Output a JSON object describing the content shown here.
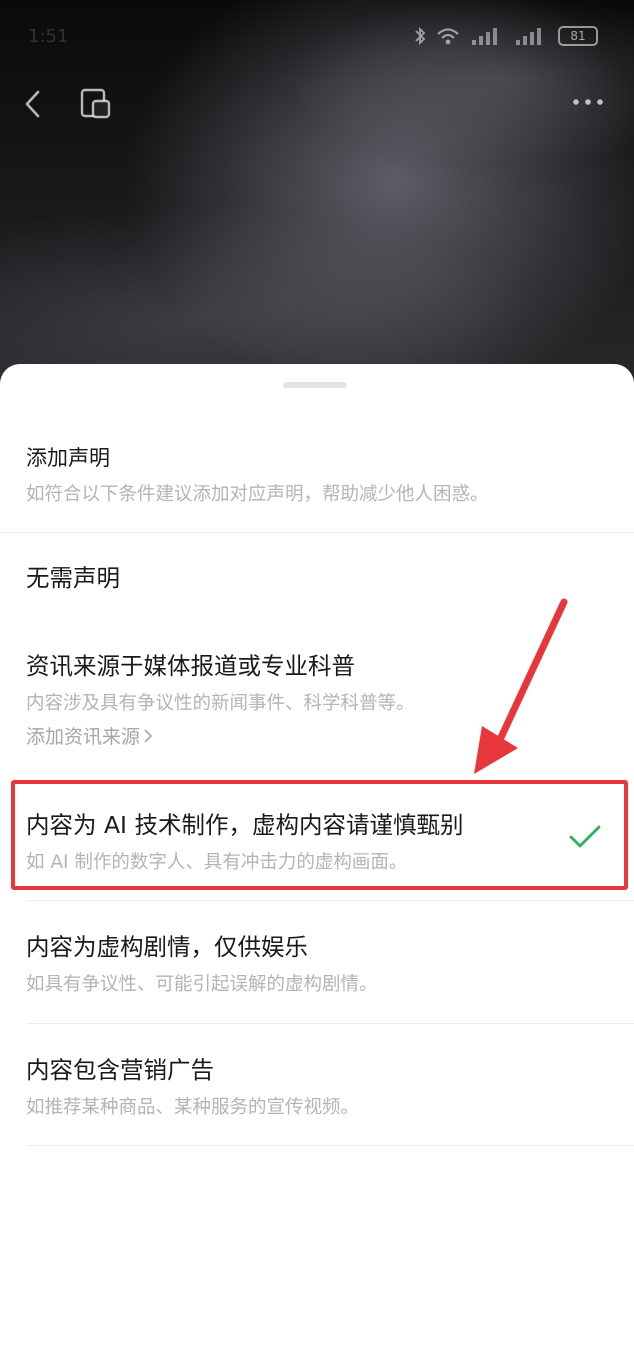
{
  "status_bar": {
    "time": "1:51",
    "battery": "81"
  },
  "nav": {
    "back_icon": "back-arrow-icon",
    "window_icon": "floating-window-icon",
    "more_icon": "more-icon"
  },
  "sheet": {
    "header": {
      "title": "添加声明",
      "subtitle": "如符合以下条件建议添加对应声明，帮助减少他人困惑。"
    },
    "options": [
      {
        "title": "无需声明",
        "subtitle": "",
        "selected": false
      },
      {
        "title": "资讯来源于媒体报道或专业科普",
        "subtitle": "内容涉及具有争议性的新闻事件、科学科普等。",
        "link": "添加资讯来源",
        "selected": false
      },
      {
        "title": "内容为 AI 技术制作，虚构内容请谨慎甄别",
        "subtitle": "如 AI 制作的数字人、具有冲击力的虚构画面。",
        "selected": true
      },
      {
        "title": "内容为虚构剧情，仅供娱乐",
        "subtitle": "如具有争议性、可能引起误解的虚构剧情。",
        "selected": false
      },
      {
        "title": "内容包含营销广告",
        "subtitle": "如推荐某种商品、某种服务的宣传视频。",
        "selected": false
      }
    ]
  },
  "colors": {
    "check": "#2bb15c",
    "highlight": "#e8363d",
    "title": "#1a1a1a",
    "subtitle": "#b4b4b4"
  }
}
